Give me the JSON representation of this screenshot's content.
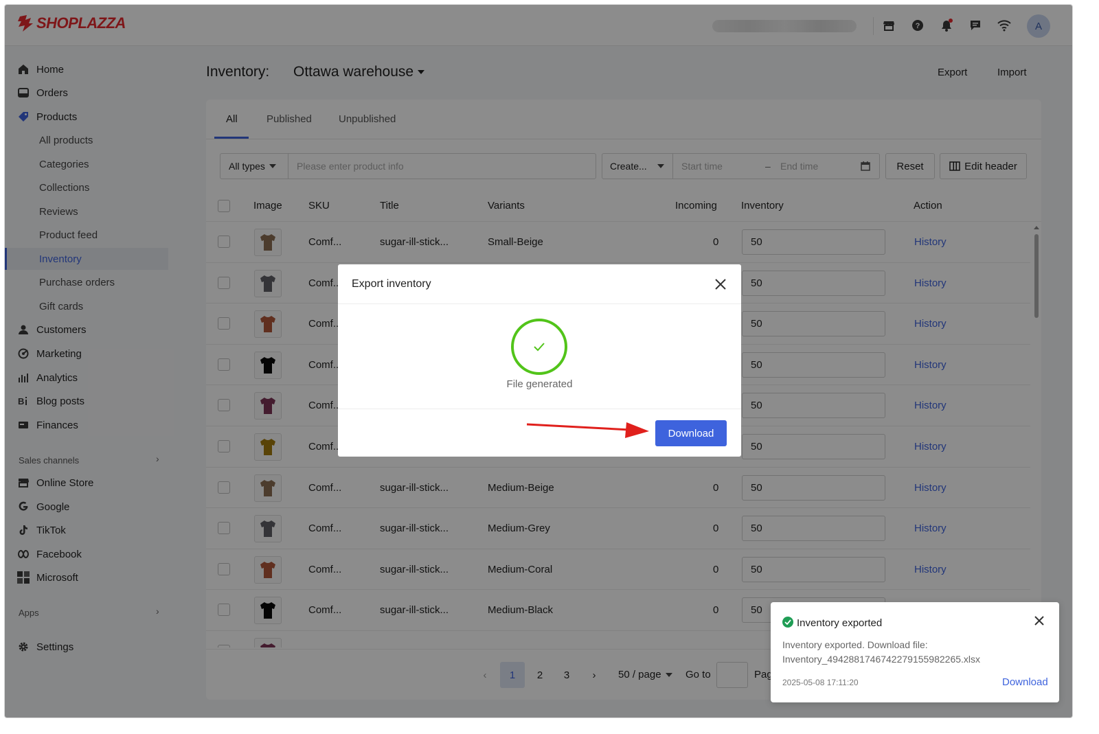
{
  "app": {
    "brand": "SHOPLAZZA",
    "avatar_initial": "A"
  },
  "icons": {
    "store": "store-icon",
    "help": "help-icon",
    "bell": "bell-icon",
    "chat": "chat-icon",
    "wifi": "wifi-icon"
  },
  "sidebar": {
    "items": [
      {
        "label": "Home",
        "icon": "home-icon"
      },
      {
        "label": "Orders",
        "icon": "orders-icon"
      },
      {
        "label": "Products",
        "icon": "tag-icon"
      }
    ],
    "product_subitems": [
      {
        "label": "All products"
      },
      {
        "label": "Categories"
      },
      {
        "label": "Collections"
      },
      {
        "label": "Reviews"
      },
      {
        "label": "Product feed"
      },
      {
        "label": "Inventory",
        "active": true
      },
      {
        "label": "Purchase orders"
      },
      {
        "label": "Gift cards"
      }
    ],
    "items2": [
      {
        "label": "Customers",
        "icon": "user-icon"
      },
      {
        "label": "Marketing",
        "icon": "marketing-icon"
      },
      {
        "label": "Analytics",
        "icon": "analytics-icon"
      },
      {
        "label": "Blog posts",
        "icon": "blog-icon"
      },
      {
        "label": "Finances",
        "icon": "finances-icon"
      }
    ],
    "sales_channels_title": "Sales channels",
    "channels": [
      {
        "label": "Online Store",
        "icon": "store-icon"
      },
      {
        "label": "Google",
        "icon": "google-icon"
      },
      {
        "label": "TikTok",
        "icon": "tiktok-icon"
      },
      {
        "label": "Facebook",
        "icon": "facebook-icon"
      },
      {
        "label": "Microsoft",
        "icon": "microsoft-icon"
      }
    ],
    "apps_title": "Apps",
    "settings": {
      "label": "Settings",
      "icon": "gear-icon"
    }
  },
  "header": {
    "title": "Inventory:",
    "warehouse": "Ottawa warehouse",
    "export": "Export",
    "import": "Import"
  },
  "tabs": [
    {
      "label": "All"
    },
    {
      "label": "Published"
    },
    {
      "label": "Unpublished"
    }
  ],
  "filters": {
    "type": "All types",
    "search_placeholder": "Please enter product info",
    "create": "Create...",
    "start_placeholder": "Start time",
    "range_sep": "–",
    "end_placeholder": "End time",
    "reset": "Reset",
    "edit_header": "Edit header"
  },
  "table": {
    "headers": {
      "image": "Image",
      "sku": "SKU",
      "title": "Title",
      "variants": "Variants",
      "incoming": "Incoming",
      "inventory": "Inventory",
      "action": "Action"
    },
    "rows": [
      {
        "sku": "Comf...",
        "title": "sugar-ill-stick...",
        "variant": "Small-Beige",
        "incoming": "0",
        "inventory": "50",
        "action": "History",
        "color": "#8a6d52"
      },
      {
        "sku": "Comf...",
        "title": "",
        "variant": "",
        "incoming": "",
        "inventory": "50",
        "action": "History",
        "color": "#5f5f66"
      },
      {
        "sku": "Comf...",
        "title": "",
        "variant": "",
        "incoming": "",
        "inventory": "50",
        "action": "History",
        "color": "#b0573a"
      },
      {
        "sku": "Comf...",
        "title": "",
        "variant": "",
        "incoming": "",
        "inventory": "50",
        "action": "History",
        "color": "#0a0a0a"
      },
      {
        "sku": "Comf...",
        "title": "",
        "variant": "",
        "incoming": "",
        "inventory": "50",
        "action": "History",
        "color": "#7c3356"
      },
      {
        "sku": "Comf...",
        "title": "",
        "variant": "",
        "incoming": "",
        "inventory": "50",
        "action": "History",
        "color": "#a27a0d"
      },
      {
        "sku": "Comf...",
        "title": "sugar-ill-stick...",
        "variant": "Medium-Beige",
        "incoming": "0",
        "inventory": "50",
        "action": "History",
        "color": "#8a6d52"
      },
      {
        "sku": "Comf...",
        "title": "sugar-ill-stick...",
        "variant": "Medium-Grey",
        "incoming": "0",
        "inventory": "50",
        "action": "History",
        "color": "#5f5f66"
      },
      {
        "sku": "Comf...",
        "title": "sugar-ill-stick...",
        "variant": "Medium-Coral",
        "incoming": "0",
        "inventory": "50",
        "action": "History",
        "color": "#b0573a"
      },
      {
        "sku": "Comf...",
        "title": "sugar-ill-stick...",
        "variant": "Medium-Black",
        "incoming": "0",
        "inventory": "50",
        "action": "History",
        "color": "#0a0a0a"
      },
      {
        "sku": "",
        "title": "",
        "variant": "",
        "incoming": "",
        "inventory": "",
        "action": "",
        "color": "#7c3356"
      }
    ]
  },
  "pagination": {
    "pages": [
      "1",
      "2",
      "3"
    ],
    "current": "1",
    "page_size": "50 / page",
    "goto": "Go to",
    "page_suffix": "Pag"
  },
  "modal": {
    "title": "Export inventory",
    "status": "File generated",
    "download": "Download"
  },
  "toast": {
    "title": "Inventory exported",
    "message": "Inventory exported. Download file:",
    "filename": "Inventory_4942881746742279155982265.xlsx",
    "time": "2025-05-08 17:11:20",
    "download": "Download"
  },
  "colors": {
    "accent": "#3e63dd",
    "success": "#52c41a",
    "brand": "#e5292f",
    "annotation_arrow": "#e0201c"
  }
}
